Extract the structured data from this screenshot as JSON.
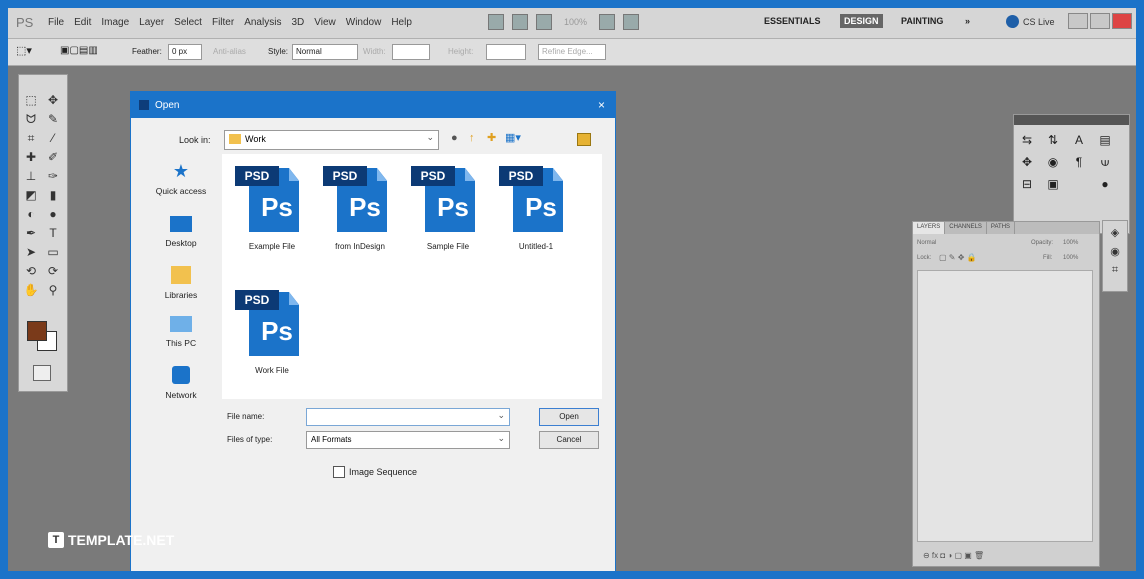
{
  "menubar": {
    "logo": "PS",
    "menus": [
      "File",
      "Edit",
      "Image",
      "Layer",
      "Select",
      "Filter",
      "Analysis",
      "3D",
      "View",
      "Window",
      "Help"
    ],
    "zoom": "100%",
    "workspaces": {
      "essentials": "ESSENTIALS",
      "design": "DESIGN",
      "painting": "PAINTING",
      "more": "»"
    },
    "cslive": "CS Live"
  },
  "optionsbar": {
    "feather_label": "Feather:",
    "feather_value": "0 px",
    "antialias": "Anti-alias",
    "style_label": "Style:",
    "style_value": "Normal",
    "width_label": "Width:",
    "height_label": "Height:",
    "refine": "Refine Edge..."
  },
  "dialog": {
    "title": "Open",
    "close": "×",
    "look_in_label": "Look in:",
    "look_in_value": "Work",
    "places": [
      "Quick access",
      "Desktop",
      "Libraries",
      "This PC",
      "Network"
    ],
    "files": [
      {
        "name": "Example File",
        "badge": "PSD",
        "glyph": "Ps"
      },
      {
        "name": "from InDesign",
        "badge": "PSD",
        "glyph": "Ps"
      },
      {
        "name": "Sample File",
        "badge": "PSD",
        "glyph": "Ps"
      },
      {
        "name": "Untitled-1",
        "badge": "PSD",
        "glyph": "Ps"
      },
      {
        "name": "Work File",
        "badge": "PSD",
        "glyph": "Ps"
      }
    ],
    "file_name_label": "File name:",
    "file_name_value": "",
    "files_of_type_label": "Files of type:",
    "files_of_type_value": "All Formats",
    "open_button": "Open",
    "cancel_button": "Cancel",
    "image_sequence": "Image Sequence"
  },
  "layers_panel": {
    "tabs": [
      "LAYERS",
      "CHANNELS",
      "PATHS"
    ],
    "blend_mode": "Normal",
    "opacity_label": "Opacity:",
    "opacity_value": "100%",
    "lock_label": "Lock:",
    "fill_label": "Fill:",
    "fill_value": "100%"
  },
  "branding": {
    "text": "TEMPLATE.NET",
    "mark": "T"
  },
  "colors": {
    "accent": "#1b73c9",
    "foreground_swatch": "#7a3a1a",
    "background_swatch": "#ffffff"
  }
}
